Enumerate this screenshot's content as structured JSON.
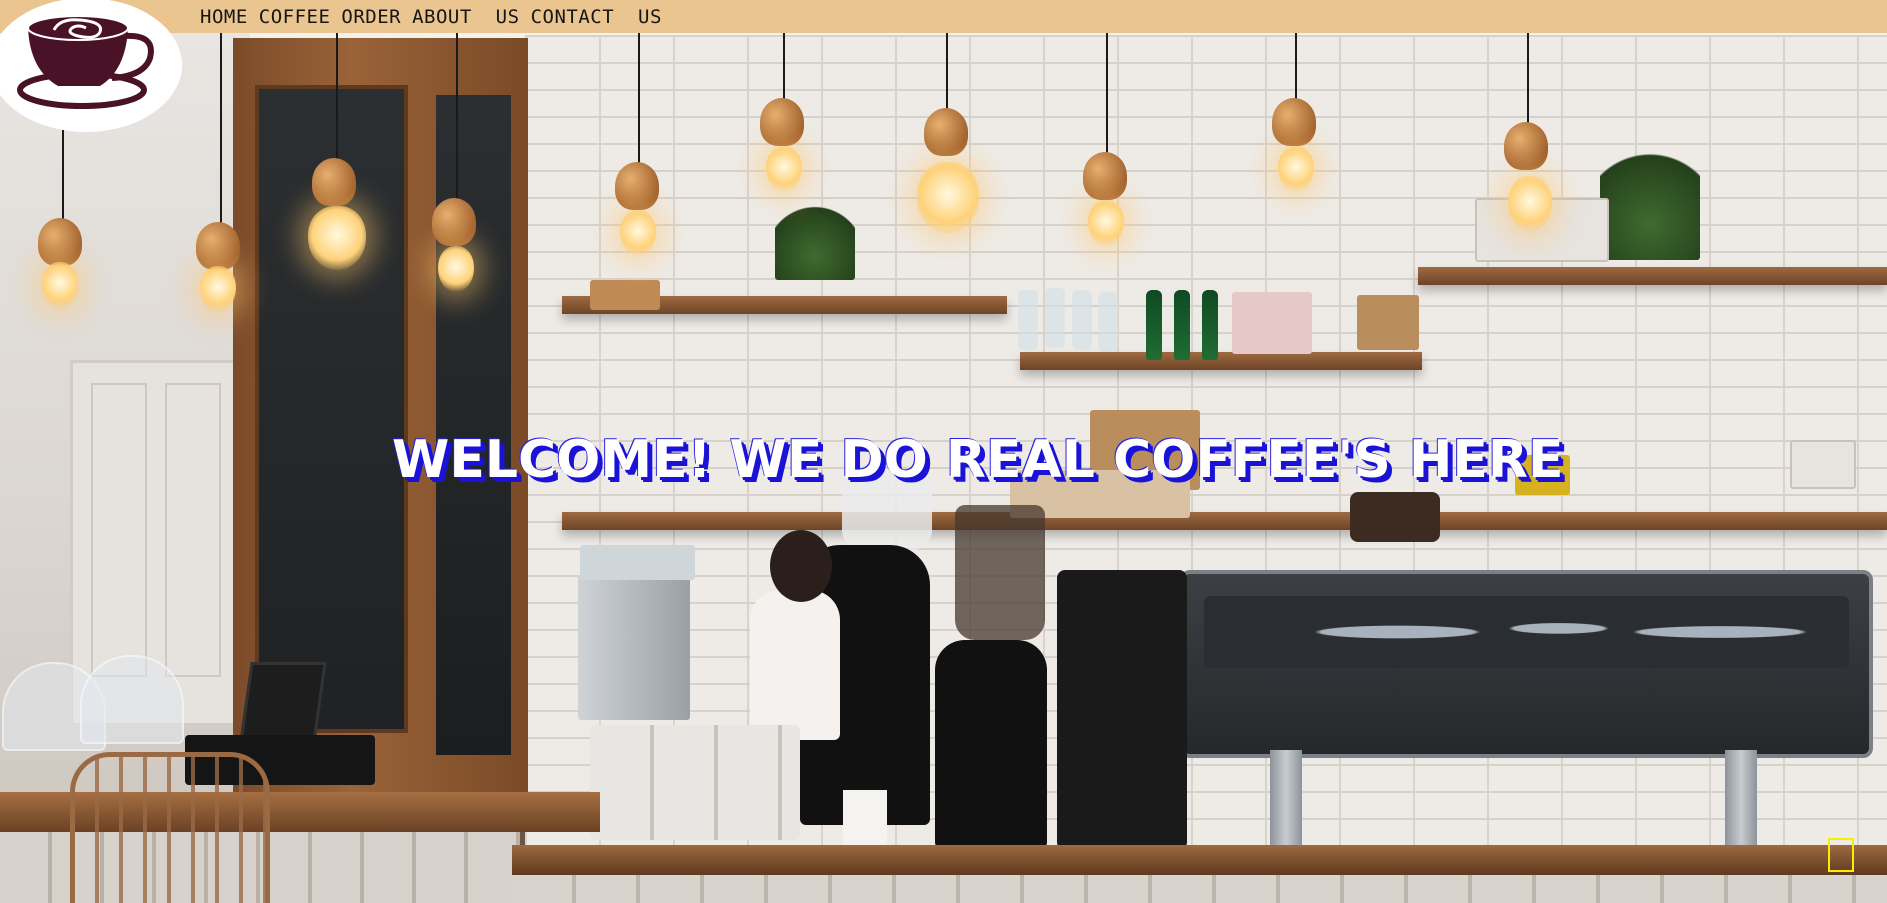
{
  "nav": {
    "links": [
      {
        "label": "HOME"
      },
      {
        "label": "COFFEE"
      },
      {
        "label": "ORDER"
      },
      {
        "label": "ABOUT  US"
      },
      {
        "label": "CONTACT  US"
      }
    ]
  },
  "logo": {
    "icon": "coffee-cup-icon",
    "color": "#4a1226"
  },
  "hero": {
    "headline": "WELCOME! WE DO REAL COFFEE'S HERE",
    "headline_shadow_color": "#1a12d6"
  },
  "scroll_button": {
    "outline_color": "#f5f000"
  },
  "colors": {
    "topbar": "#ebc58f"
  }
}
